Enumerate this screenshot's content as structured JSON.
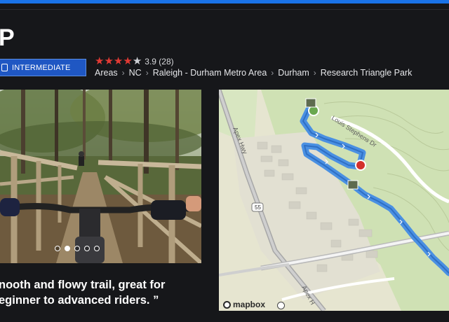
{
  "header": {
    "title": "P"
  },
  "difficulty": {
    "label": "INTERMEDIATE"
  },
  "rating": {
    "stars_filled": 4,
    "stars_total": 5,
    "text": "3.9 (28)"
  },
  "breadcrumb": {
    "items": [
      "Areas",
      "NC",
      "Raleigh - Durham Metro Area",
      "Durham",
      "Research Triangle Park"
    ],
    "separator": "›"
  },
  "photo": {
    "slide_count": 5,
    "active_index": 0
  },
  "quote": {
    "line1": "nooth and flowy trail, great for",
    "line2": "eginner to advanced riders. ”"
  },
  "map": {
    "road_labels": [
      "Apex Hwy",
      "Louis Stephens Dr",
      "55",
      "Apex H"
    ],
    "attribution": "mapbox"
  },
  "colors": {
    "accent": "#1a73e8",
    "badge": "#1f57c3",
    "star": "#e23a34",
    "trail": "#4a90e2"
  }
}
